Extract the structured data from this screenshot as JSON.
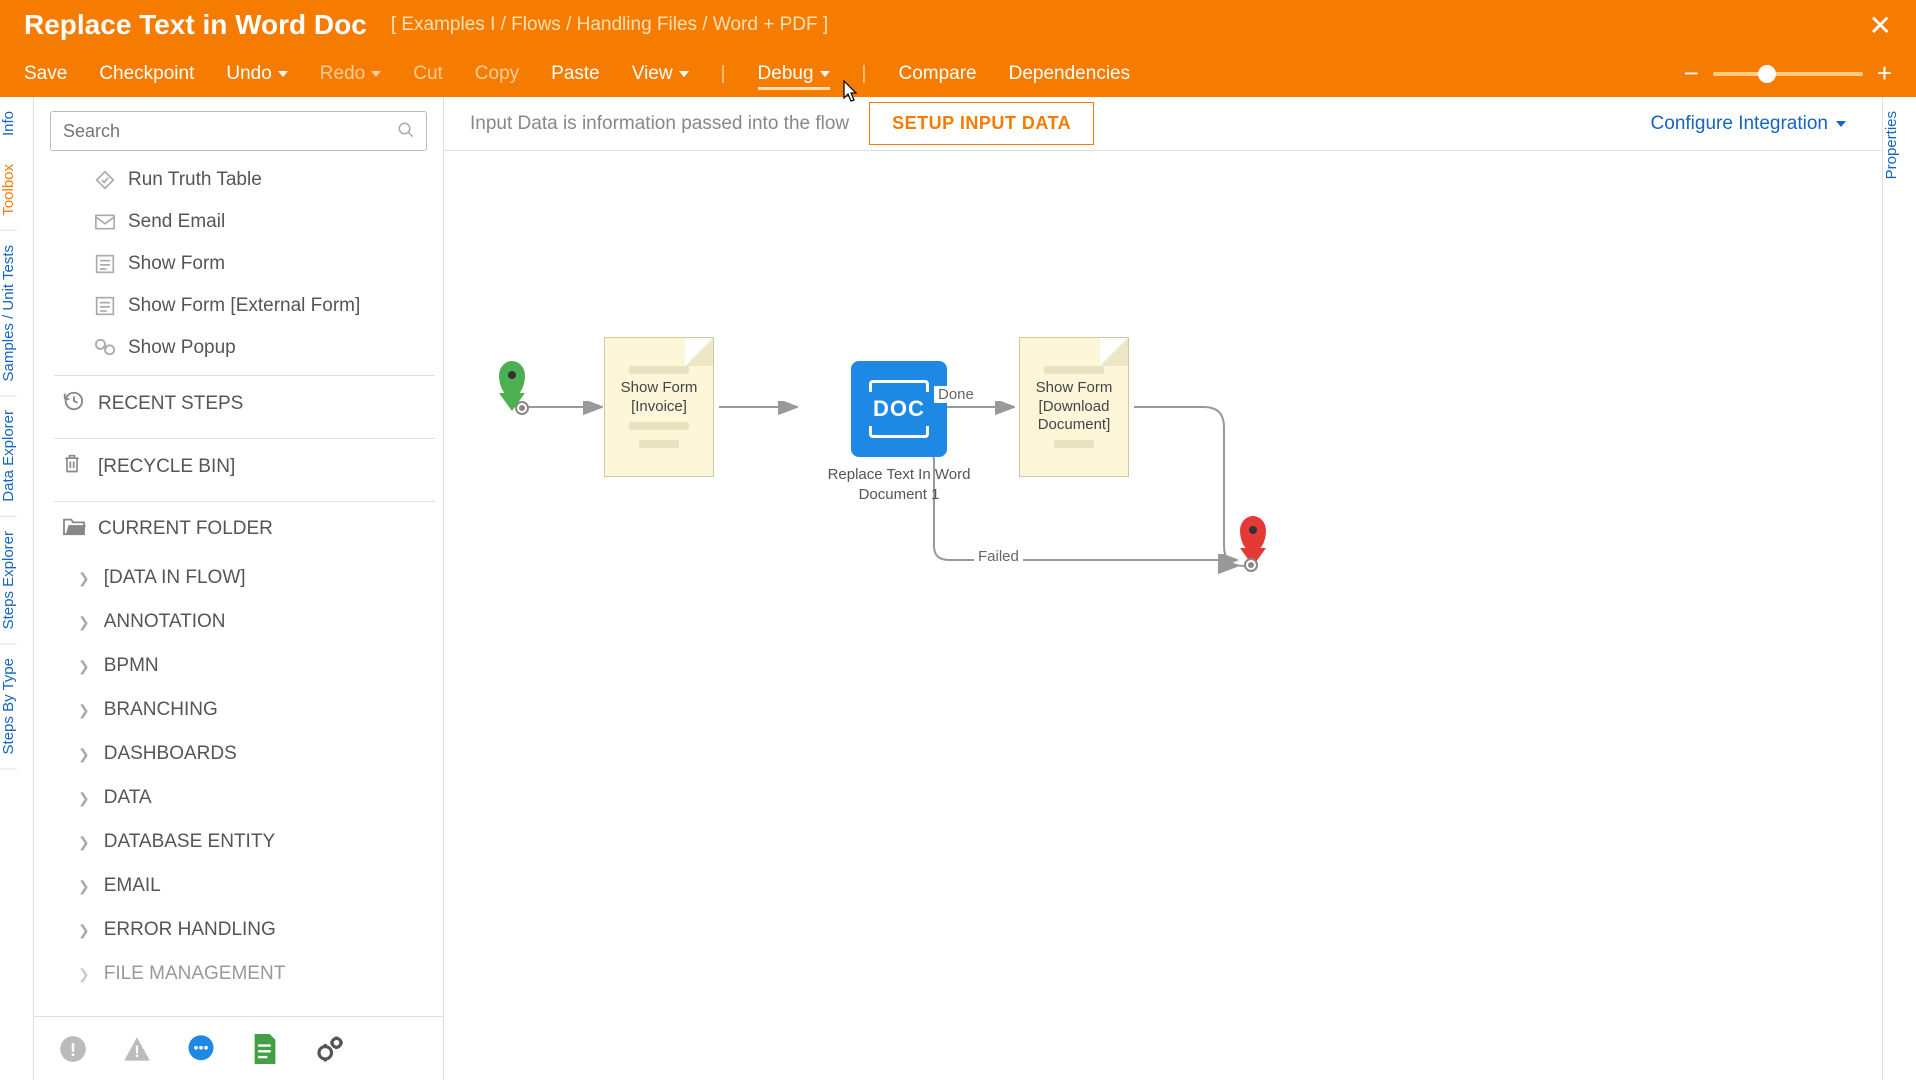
{
  "header": {
    "title": "Replace Text in Word Doc",
    "breadcrumb": "[ Examples I / Flows / Handling Files / Word + PDF ]"
  },
  "menu": {
    "save": "Save",
    "checkpoint": "Checkpoint",
    "undo": "Undo",
    "redo": "Redo",
    "cut": "Cut",
    "copy": "Copy",
    "paste": "Paste",
    "view": "View",
    "debug": "Debug",
    "compare": "Compare",
    "dependencies": "Dependencies"
  },
  "subbar": {
    "hint": "Input Data is information passed into the flow",
    "setup_button": "SETUP INPUT DATA",
    "configure": "Configure Integration"
  },
  "left_rail": [
    "Info",
    "Toolbox",
    "Samples / Unit Tests",
    "Data Explorer",
    "Steps Explorer",
    "Steps By Type"
  ],
  "right_rail": [
    "Properties"
  ],
  "search": {
    "placeholder": "Search"
  },
  "toolbox_items": [
    {
      "label": "Run Truth Table",
      "icon": "diamond"
    },
    {
      "label": "Send Email",
      "icon": "mail"
    },
    {
      "label": "Show Form",
      "icon": "form"
    },
    {
      "label": "Show Form [External Form]",
      "icon": "form"
    },
    {
      "label": "Show Popup",
      "icon": "popup"
    }
  ],
  "sections": {
    "recent": "RECENT STEPS",
    "recycle": "[RECYCLE BIN]",
    "current": "CURRENT FOLDER"
  },
  "folders": [
    "[DATA IN FLOW]",
    "ANNOTATION",
    "BPMN",
    "BRANCHING",
    "DASHBOARDS",
    "DATA",
    "DATABASE ENTITY",
    "EMAIL",
    "ERROR HANDLING",
    "FILE MANAGEMENT"
  ],
  "canvas": {
    "node1": {
      "line1": "Show Form",
      "line2": "[Invoice]"
    },
    "node2": {
      "label": "Replace Text In Word Document 1",
      "icon_text": "DOC"
    },
    "node3": {
      "line1": "Show Form",
      "line2": "[Download",
      "line3": "Document]"
    },
    "edge_done": "Done",
    "edge_failed": "Failed"
  }
}
